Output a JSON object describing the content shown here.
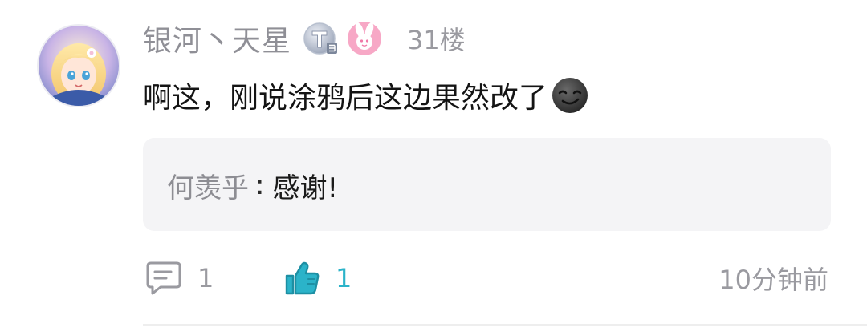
{
  "comment": {
    "username": "银河丶天星",
    "level_badge_icon": "level-badge-t3-icon",
    "fan_badge_icon": "pink-bunny-badge-icon",
    "floor": "31楼",
    "text": "啊这，刚说涂鸦后这边果然改了",
    "emoji_icon": "smirk-emoji-icon"
  },
  "reply": {
    "author": "何羡乎",
    "separator": ":",
    "text": "感谢!"
  },
  "actions": {
    "reply_count": "1",
    "like_count": "1",
    "like_color": "#2bb3c9"
  },
  "timestamp": "10分钟前"
}
